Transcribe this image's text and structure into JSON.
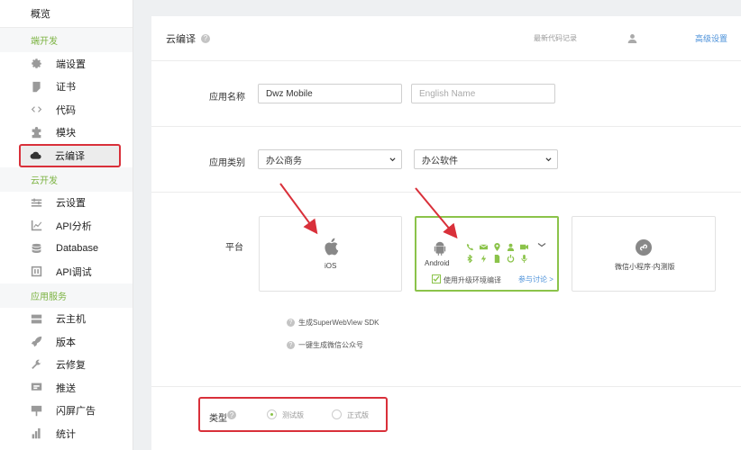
{
  "sidebar": {
    "overview": "概览",
    "sections": [
      {
        "title": "端开发",
        "items": [
          {
            "label": "端设置",
            "icon": "gear-icon"
          },
          {
            "label": "证书",
            "icon": "certificate-icon"
          },
          {
            "label": "代码",
            "icon": "code-icon"
          },
          {
            "label": "模块",
            "icon": "puzzle-icon"
          },
          {
            "label": "云编译",
            "icon": "cloud-icon"
          }
        ]
      },
      {
        "title": "云开发",
        "items": [
          {
            "label": "云设置",
            "icon": "sliders-icon"
          },
          {
            "label": "API分析",
            "icon": "chart-line-icon"
          },
          {
            "label": "Database",
            "icon": "database-icon"
          },
          {
            "label": "API调试",
            "icon": "debug-icon"
          }
        ]
      },
      {
        "title": "应用服务",
        "items": [
          {
            "label": "云主机",
            "icon": "server-icon"
          },
          {
            "label": "版本",
            "icon": "rocket-icon"
          },
          {
            "label": "云修复",
            "icon": "wrench-icon"
          },
          {
            "label": "推送",
            "icon": "push-icon"
          },
          {
            "label": "闪屏广告",
            "icon": "billboard-icon"
          },
          {
            "label": "统计",
            "icon": "bar-chart-icon"
          }
        ]
      }
    ]
  },
  "header": {
    "title": "云编译",
    "latest_records": "最新代码记录",
    "advanced_settings": "高级设置"
  },
  "form": {
    "app_name_label": "应用名称",
    "app_name_value": "Dwz Mobile",
    "english_name_placeholder": "English Name",
    "category_label": "应用类别",
    "category_primary": "办公商务",
    "category_secondary": "办公软件",
    "platform_label": "平台",
    "platforms": {
      "ios": "iOS",
      "android": "Android",
      "wechat": "微信小程序·内测版"
    },
    "upgrade_env": "使用升级环境编译",
    "discuss_link": "参与讨论 >",
    "superwebview_note": "生成SuperWebView SDK",
    "wechat_public_note": "一键生成微信公众号",
    "type_label": "类型",
    "type_options": [
      "测试版",
      "正式版"
    ],
    "type_selected": "测试版"
  },
  "colors": {
    "accent_green": "#8bc34a",
    "highlight_red": "#d9303a",
    "link_blue": "#4a90d9"
  }
}
